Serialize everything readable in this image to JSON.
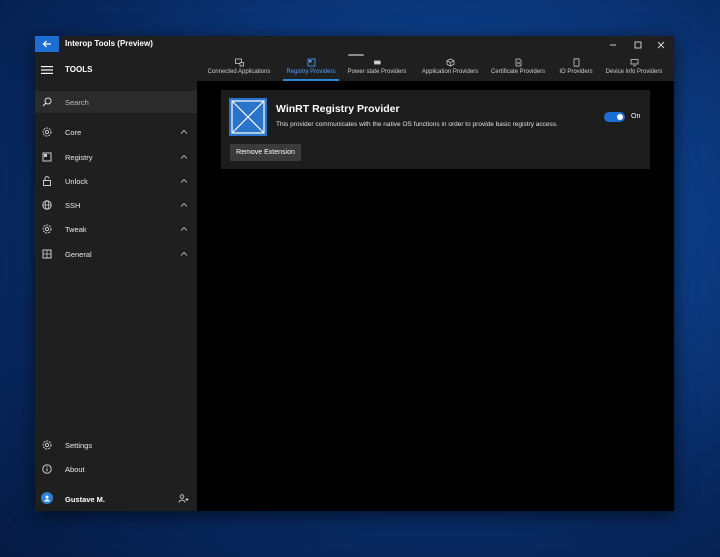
{
  "app": {
    "title": "Interop Tools (Preview)"
  },
  "sidebar": {
    "header": "TOOLS",
    "search_label": "Search",
    "items": [
      {
        "label": "Core",
        "icon": "gear-icon"
      },
      {
        "label": "Registry",
        "icon": "registry-icon"
      },
      {
        "label": "Unlock",
        "icon": "lock-icon"
      },
      {
        "label": "SSH",
        "icon": "globe-icon"
      },
      {
        "label": "Tweak",
        "icon": "gear-icon"
      },
      {
        "label": "General",
        "icon": "grid-icon"
      }
    ],
    "footer": [
      {
        "label": "Settings",
        "icon": "gear-icon"
      },
      {
        "label": "About",
        "icon": "info-icon"
      }
    ],
    "user": {
      "name": "Gustave M."
    }
  },
  "tabs": [
    {
      "label": "Connected Applications",
      "icon": "connected-apps-icon"
    },
    {
      "label": "Registry Providers",
      "icon": "registry-icon",
      "active": true
    },
    {
      "label": "Power state Providers",
      "icon": "battery-icon"
    },
    {
      "label": "Application Providers",
      "icon": "package-icon"
    },
    {
      "label": "Certificate Providers",
      "icon": "certificate-icon"
    },
    {
      "label": "IO Providers",
      "icon": "device-icon"
    },
    {
      "label": "Device info Providers",
      "icon": "monitor-icon"
    }
  ],
  "provider": {
    "title": "WinRT Registry Provider",
    "description": "This provider communicates with the native OS functions in order to provide basic registry access.",
    "toggle_state": "On",
    "enabled": true,
    "remove_label": "Remove Extension"
  },
  "colors": {
    "accent": "#1b6ed4",
    "sidebar_bg": "#1f1f1f",
    "card_bg": "#1c1c1c",
    "content_bg": "#000000"
  }
}
